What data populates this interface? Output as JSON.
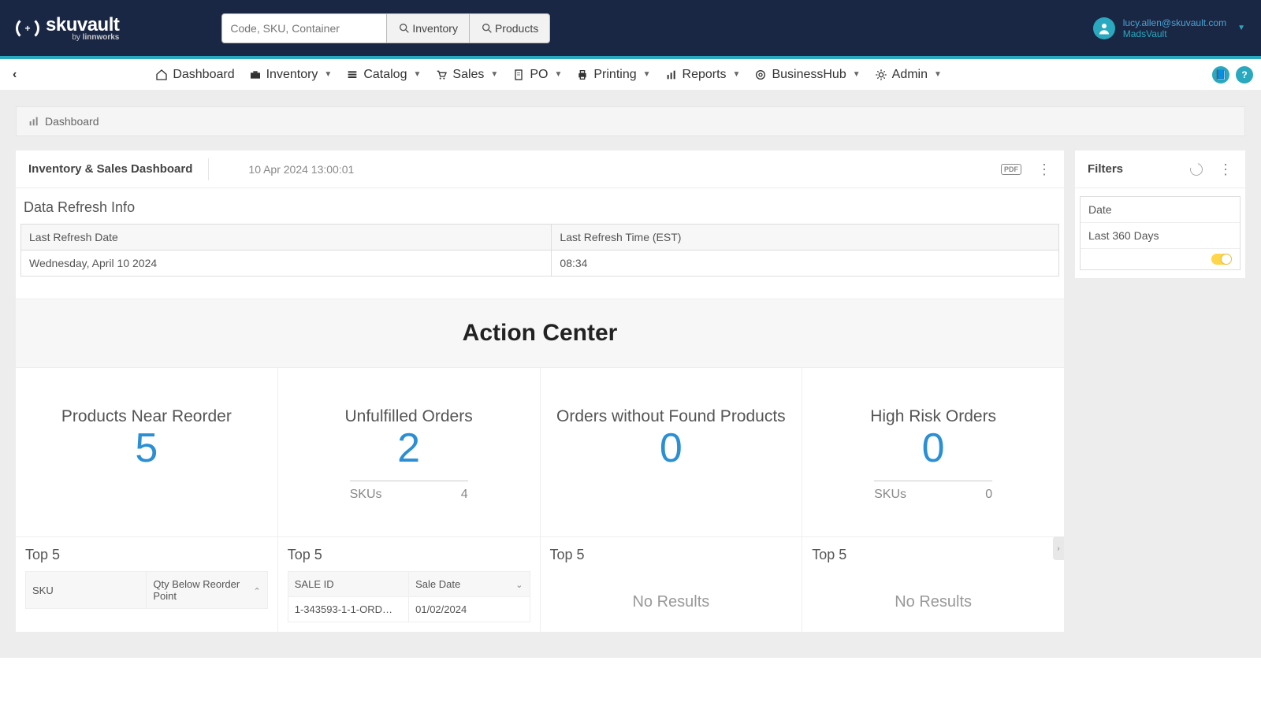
{
  "brand": {
    "name": "skuvault",
    "by": "by ",
    "parent": "linnworks"
  },
  "search": {
    "placeholder": "Code, SKU, Container",
    "btn_inventory": "Inventory",
    "btn_products": "Products"
  },
  "user": {
    "email": "lucy.allen@skuvault.com",
    "account": "MadsVault"
  },
  "nav": {
    "dashboard": "Dashboard",
    "inventory": "Inventory",
    "catalog": "Catalog",
    "sales": "Sales",
    "po": "PO",
    "printing": "Printing",
    "reports": "Reports",
    "businesshub": "BusinessHub",
    "admin": "Admin"
  },
  "breadcrumb": "Dashboard",
  "panel": {
    "title": "Inventory & Sales Dashboard",
    "timestamp": "10 Apr 2024 13:00:01",
    "pdf": "PDF"
  },
  "refresh": {
    "title": "Data Refresh Info",
    "h_date": "Last Refresh Date",
    "h_time": "Last Refresh Time (EST)",
    "v_date": "Wednesday, April 10 2024",
    "v_time": "08:34"
  },
  "action_center": "Action Center",
  "cards": {
    "reorder": {
      "title": "Products Near Reorder",
      "value": "5"
    },
    "unfulfilled": {
      "title": "Unfulfilled Orders",
      "value": "2",
      "sub_l": "SKUs",
      "sub_v": "4"
    },
    "nofound": {
      "title": "Orders without Found Products",
      "value": "0"
    },
    "highrisk": {
      "title": "High Risk Orders",
      "value": "0",
      "sub_l": "SKUs",
      "sub_v": "0"
    }
  },
  "tops": {
    "label": "Top 5",
    "reorder": {
      "h1": "SKU",
      "h2": "Qty Below Reorder Point"
    },
    "unfulfilled": {
      "h1": "SALE ID",
      "h2": "Sale Date",
      "r1c1": "1-343593-1-1-ORD…",
      "r1c2": "01/02/2024"
    },
    "no_results": "No Results"
  },
  "filters": {
    "title": "Filters",
    "date_label": "Date",
    "date_value": "Last 360 Days"
  }
}
